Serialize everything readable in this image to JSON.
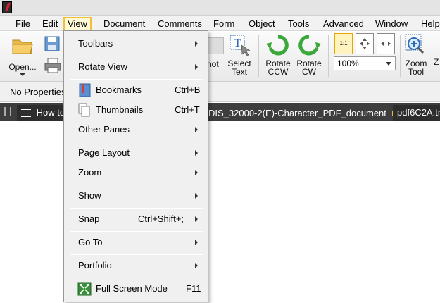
{
  "menubar": {
    "items": [
      "File",
      "Edit",
      "View",
      "Document",
      "Comments",
      "Form",
      "Object",
      "Tools",
      "Advanced",
      "Window",
      "Help"
    ],
    "active": "View"
  },
  "toolbar": {
    "open_label": "Open...",
    "shot_label": "hot",
    "select_text_line1": "Select",
    "select_text_line2": "Text",
    "rotate_ccw_line1": "Rotate",
    "rotate_ccw_line2": "CCW",
    "rotate_cw_line1": "Rotate",
    "rotate_cw_line2": "CW",
    "actual_size_label": "1:1",
    "zoom_value": "100%",
    "zoom_tool_line1": "Zoom",
    "zoom_tool_line2": "Tool",
    "last_label_fragment": "Z"
  },
  "properties": {
    "label": "No Properties"
  },
  "tabs": {
    "tab1": "How to",
    "tab2": "DIS_32000-2(E)-Character_PDF_document",
    "tab2_close": "×",
    "tab3": "pdf6C2A.tm"
  },
  "view_menu": {
    "toolbars": "Toolbars",
    "rotate_view": "Rotate View",
    "bookmarks": "Bookmarks",
    "bookmarks_shortcut": "Ctrl+B",
    "thumbnails": "Thumbnails",
    "thumbnails_shortcut": "Ctrl+T",
    "other_panes": "Other Panes",
    "page_layout": "Page Layout",
    "zoom": "Zoom",
    "show": "Show",
    "snap": "Snap",
    "snap_shortcut": "Ctrl+Shift+;",
    "go_to": "Go To",
    "portfolio": "Portfolio",
    "full_screen": "Full Screen Mode",
    "full_screen_shortcut": "F11"
  },
  "colors": {
    "accent_rotate": "#3aa83a",
    "menu_highlight_border": "#f0c23c",
    "tabbar_bg": "#3d3d3d"
  }
}
